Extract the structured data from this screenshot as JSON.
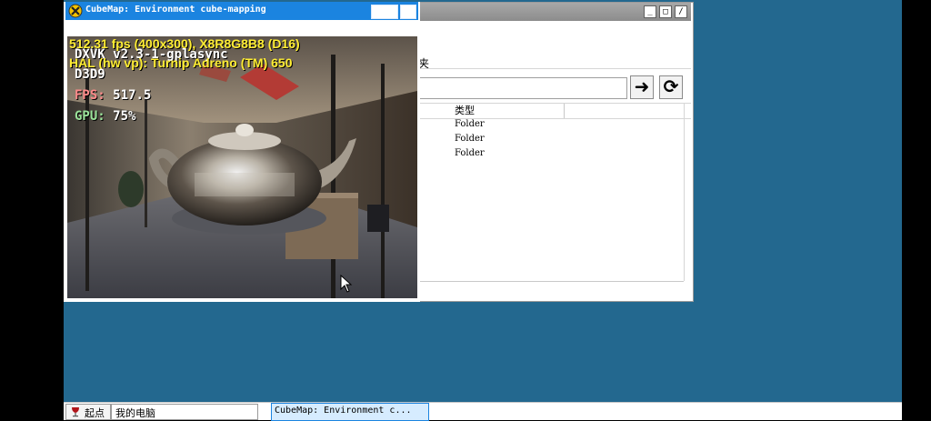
{
  "explorer": {
    "menu_label": "夹",
    "column_type": "类型",
    "rows": [
      "Folder",
      "Folder",
      "Folder"
    ],
    "buttons": {
      "go": "➜",
      "refresh": "⟳"
    }
  },
  "cubemap": {
    "title": "CubeMap: Environment cube-mapping",
    "hud": {
      "fps_line": "512.31 fps (400x300), X8R8G8B8 (D16)",
      "hal_line": "HAL (hw vp): Turnip Adreno (TM) 650",
      "dxvk_line": "DXVK v2.3-1-gplasync",
      "api": "D3D9",
      "fps_label": "FPS:",
      "fps_value": "517.5",
      "gpu_label": "GPU:",
      "gpu_value": "75%"
    }
  },
  "taskbar": {
    "start_label": "起点",
    "mypc_label": "我的电脑",
    "task_label": "CubeMap: Environment c..."
  },
  "colors": {
    "desktop": "#23688f",
    "titlebar_active": "#1b84e0",
    "hud_yellow": "#ffee33",
    "fps_red": "#ff8a8a",
    "gpu_green": "#9ae29a"
  }
}
